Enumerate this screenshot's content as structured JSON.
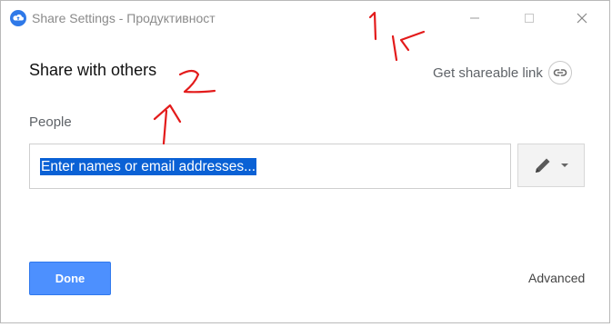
{
  "window": {
    "title": "Share Settings - Продуктивност",
    "app_icon": "cloud-upload-icon",
    "controls": [
      "minimize-icon",
      "maximize-icon",
      "close-icon"
    ]
  },
  "dialog": {
    "title": "Share with others",
    "shareable_link": {
      "label": "Get shareable link",
      "icon": "link-icon"
    },
    "people_label": "People",
    "people_input": {
      "placeholder": "Enter names or email addresses...",
      "selected": true
    },
    "permission_button": {
      "icon": "pencil-icon",
      "dropdown_icon": "caret-down-icon"
    },
    "done_label": "Done",
    "advanced_label": "Advanced"
  },
  "annotations": [
    {
      "text": "1",
      "icon": "arrow-icon",
      "color": "#e31b1b"
    },
    {
      "text": "2",
      "icon": "arrow-icon",
      "color": "#e31b1b"
    }
  ],
  "colors": {
    "primary_button": "#4d90fe",
    "selection_highlight": "#0a61d5",
    "annotation_red": "#e31b1b"
  }
}
